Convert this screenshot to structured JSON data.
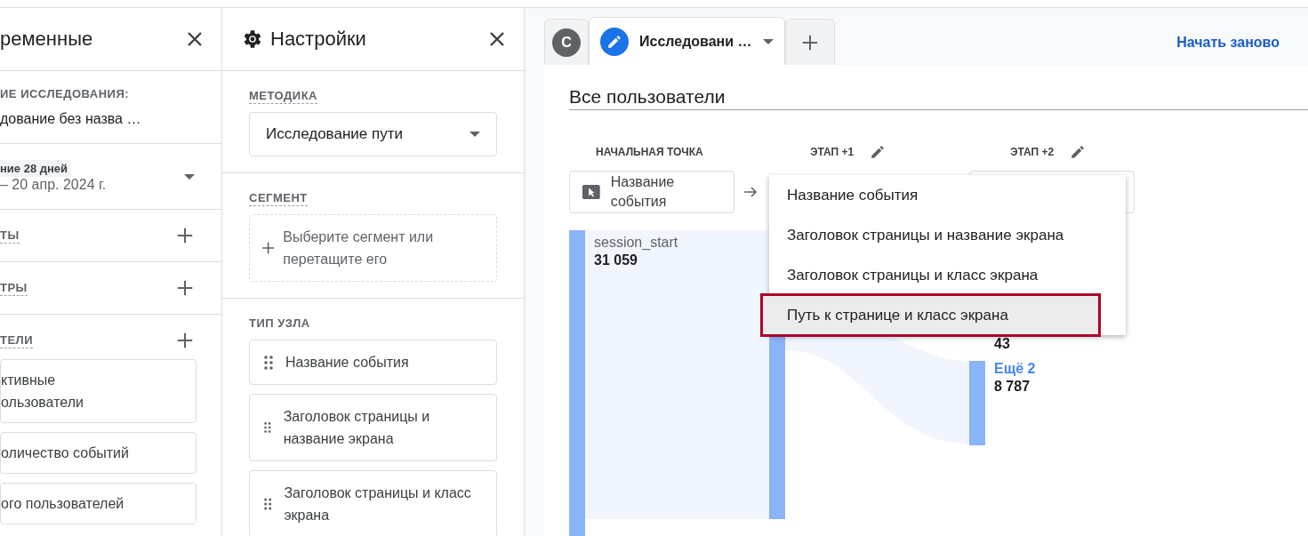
{
  "explorations_panel": {
    "title": "ременные",
    "name_label": "ИЕ ИССЛЕДОВАНИЯ:",
    "name_value": "дование без назва …",
    "date_range": {
      "preset": "ние 28 дней",
      "dates": "– 20 апр. 2024 г."
    },
    "sections": [
      {
        "label": "ТЫ"
      },
      {
        "label": "ТРЫ"
      },
      {
        "label": "ТЕЛИ",
        "chips": [
          {
            "text": "ктивные\nользователи"
          },
          {
            "text": "оличество событий"
          },
          {
            "text": "ого пользователей"
          }
        ]
      }
    ]
  },
  "settings_panel": {
    "title": "Настройки",
    "technique_label": "МЕТОДИКА",
    "technique": "Исследование пути",
    "segment_label": "СЕГМЕНТ",
    "segment_placeholder": "Выберите сегмент или перетащите его",
    "node_type_label": "ТИП УЗЛА",
    "node_types": [
      {
        "label": "Название события"
      },
      {
        "label": "Заголовок страницы и название экрана"
      },
      {
        "label": "Заголовок страницы и класс экрана"
      }
    ]
  },
  "tabs": [
    {
      "kind": "avatar",
      "label": "C",
      "selected": false
    },
    {
      "kind": "exploration",
      "label": "Исследовани …",
      "selected": true
    },
    {
      "kind": "add",
      "selected": false
    }
  ],
  "reset_link": "Начать заново",
  "segment_title": "Все пользователи",
  "steps": [
    {
      "label": "НАЧАЛЬНАЯ ТОЧКА",
      "editable": false,
      "node": "Название события"
    },
    {
      "label": "ЭТАП +1",
      "editable": true
    },
    {
      "label": "ЭТАП +2",
      "editable": true
    }
  ],
  "sankey_nodes": [
    {
      "kind": "node",
      "name": "session_start",
      "value": "31 059"
    },
    {
      "kind": "value_only",
      "value": "43"
    },
    {
      "kind": "more",
      "name": "Ещё 2",
      "value": "8 787"
    }
  ],
  "node_menu": [
    {
      "label": "Название события",
      "selected": false
    },
    {
      "label": "Заголовок страницы и название экрана",
      "selected": false
    },
    {
      "label": "Заголовок страницы и класс экрана",
      "selected": false
    },
    {
      "label": "Путь к странице и класс экрана",
      "selected": true
    }
  ]
}
